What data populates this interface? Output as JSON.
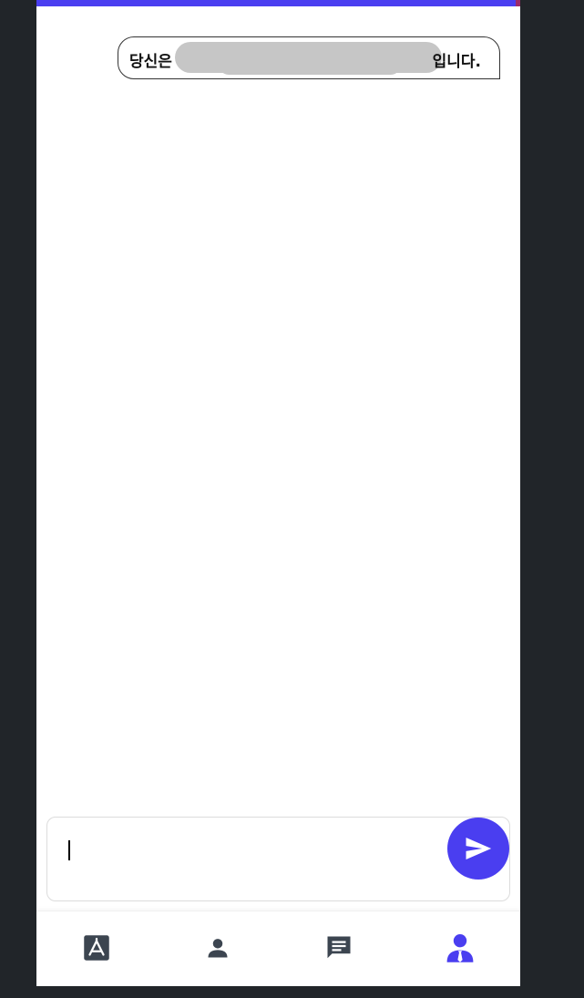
{
  "colors": {
    "accent": "#4a3ef0",
    "icon_inactive": "#3c4550",
    "background": "#212529"
  },
  "chat": {
    "messages": [
      {
        "prefix": "당신은",
        "suffix": "입니다.",
        "redacted": true
      }
    ]
  },
  "composer": {
    "value": "",
    "send_icon": "send-icon"
  },
  "nav": {
    "items": [
      {
        "icon": "app-store-icon",
        "active": false
      },
      {
        "icon": "person-icon",
        "active": false
      },
      {
        "icon": "chat-icon",
        "active": false
      },
      {
        "icon": "user-tie-icon",
        "active": true
      }
    ]
  }
}
